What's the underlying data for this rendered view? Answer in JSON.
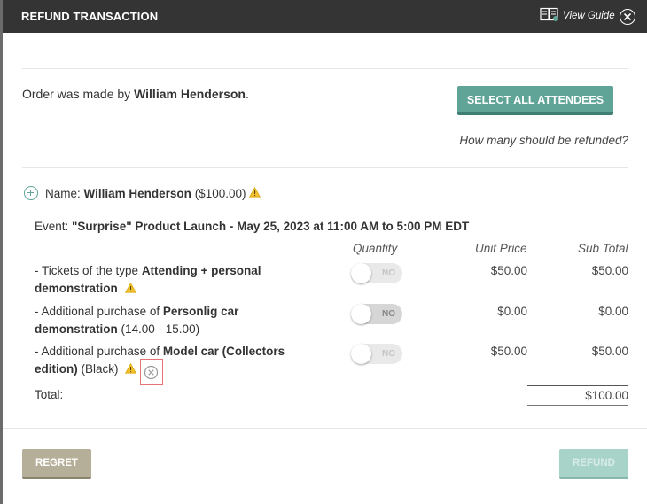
{
  "header": {
    "title": "REFUND TRANSACTION",
    "guide_label": "View Guide"
  },
  "order": {
    "made_by_prefix": "Order was made by ",
    "made_by_name": "William Henderson",
    "made_by_suffix": ".",
    "select_all_label": "SELECT ALL ATTENDEES",
    "how_many_label": "How many should be refunded?"
  },
  "attendee": {
    "name_prefix": "Name: ",
    "name": "William Henderson",
    "amount": "($100.00)",
    "event_prefix": "Event: ",
    "event_name": "\"Surprise\" Product Launch - May 25, 2023 at 11:00 AM to 5:00 PM EDT"
  },
  "columns": {
    "quantity": "Quantity",
    "unit_price": "Unit Price",
    "sub_total": "Sub Total"
  },
  "items": [
    {
      "prefix": "- Tickets of the type ",
      "name": "Attending + personal demonstration",
      "suffix": "",
      "toggle_label": "NO",
      "unit_price": "$50.00",
      "sub_total": "$50.00"
    },
    {
      "prefix": "- Additional purchase of ",
      "name": "Personlig car demonstration",
      "suffix": " (14.00 - 15.00)",
      "toggle_label": "NO",
      "unit_price": "$0.00",
      "sub_total": "$0.00"
    },
    {
      "prefix": "- Additional purchase of ",
      "name": "Model car (Collectors edition)",
      "suffix": " (Black)",
      "toggle_label": "NO",
      "unit_price": "$50.00",
      "sub_total": "$50.00"
    }
  ],
  "totals": {
    "label": "Total:",
    "value": "$100.00"
  },
  "footer": {
    "regret_label": "REGRET",
    "refund_label": "REFUND"
  },
  "colors": {
    "header_bg": "#343434",
    "accent": "#5fa497",
    "warning": "#f2c12e",
    "remove_highlight": "#e57373"
  }
}
